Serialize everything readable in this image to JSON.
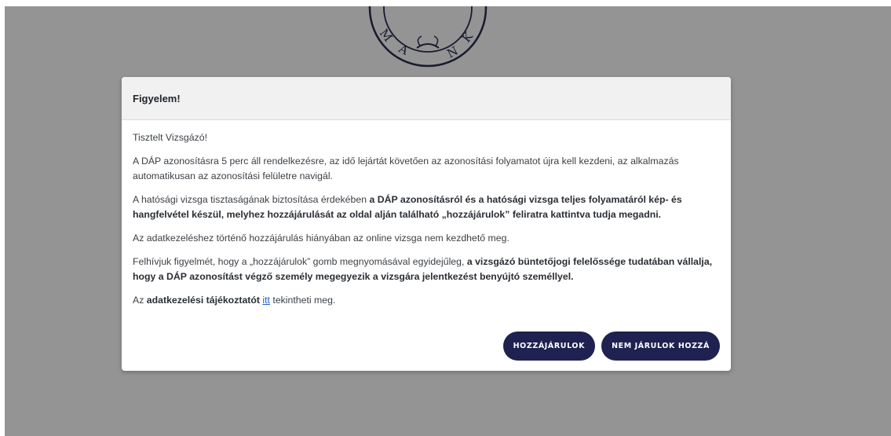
{
  "seal": {
    "letters": [
      "M",
      "A",
      "N",
      "K"
    ]
  },
  "modal": {
    "title": "Figyelem!",
    "greeting": "Tisztelt Vizsgázó!",
    "p1": "A DÁP azonosításra 5 perc áll rendelkezésre, az idő lejártát követően az azonosítási folyamatot újra kell kezdeni, az alkalmazás automatikusan az azonosítási felületre navigál.",
    "p2_prefix": "A hatósági vizsga tisztaságának biztosítása érdekében ",
    "p2_bold": "a DÁP azonosításról és a hatósági vizsga teljes folyamatáról kép- és hangfelvétel készül, melyhez hozzájárulását az oldal alján található „hozzájárulok” feliratra kattintva tudja megadni.",
    "p3": "Az adatkezeléshez történő hozzájárulás hiányában az online vizsga nem kezdhető meg.",
    "p4_prefix": "Felhívjuk figyelmét, hogy a „hozzájárulok” gomb megnyomásával egyidejűleg, ",
    "p4_bold": "a vizsgázó büntetőjogi felelőssége tudatában vállalja, hogy a DÁP azonosítást végző személy megegyezik a vizsgára jelentkezést benyújtó személlyel.",
    "p5_prefix": "Az ",
    "p5_bold": "adatkezelési tájékoztatót",
    "p5_link": "itt",
    "p5_suffix": " tekintheti meg.",
    "accept_label": "HOZZÁJÁRULOK",
    "decline_label": "NEM JÁRULOK HOZZÁ"
  },
  "colors": {
    "button_bg": "#1f2150",
    "link": "#1a5ccf",
    "overlay": "rgba(0,0,0,0.42)"
  }
}
